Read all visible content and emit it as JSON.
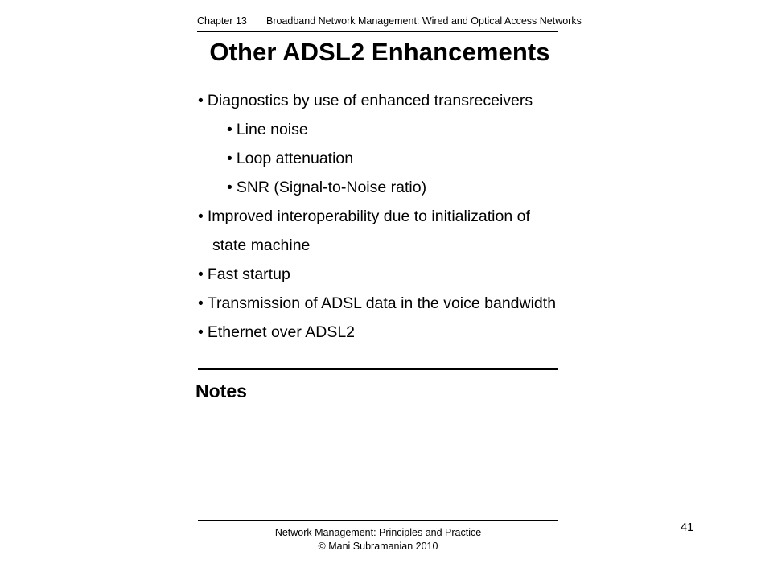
{
  "header": {
    "chapter": "Chapter 13",
    "title": "Broadband Network Management:  Wired and Optical Access Networks"
  },
  "slide": {
    "title": "Other ADSL2 Enhancements",
    "bullet_marker": "•",
    "bullets": [
      {
        "level": 1,
        "text": "Diagnostics by use of enhanced transreceivers",
        "marker": true
      },
      {
        "level": 2,
        "text": "Line noise",
        "marker": true
      },
      {
        "level": 2,
        "text": "Loop attenuation",
        "marker": true
      },
      {
        "level": 2,
        "text": "SNR (Signal-to-Noise ratio)",
        "marker": true
      },
      {
        "level": 1,
        "text": "Improved interoperability due to initialization of",
        "marker": true
      },
      {
        "level": 0,
        "text": "state machine",
        "marker": false
      },
      {
        "level": 1,
        "text": "Fast startup",
        "marker": true
      },
      {
        "level": 1,
        "text": "Transmission of ADSL data in the voice bandwidth",
        "marker": true
      },
      {
        "level": 1,
        "text": "Ethernet over ADSL2",
        "marker": true
      }
    ]
  },
  "notes": {
    "label": "Notes"
  },
  "footer": {
    "line1": "Network Management: Principles and Practice",
    "line2": "©  Mani Subramanian 2010",
    "page_number": "41"
  }
}
